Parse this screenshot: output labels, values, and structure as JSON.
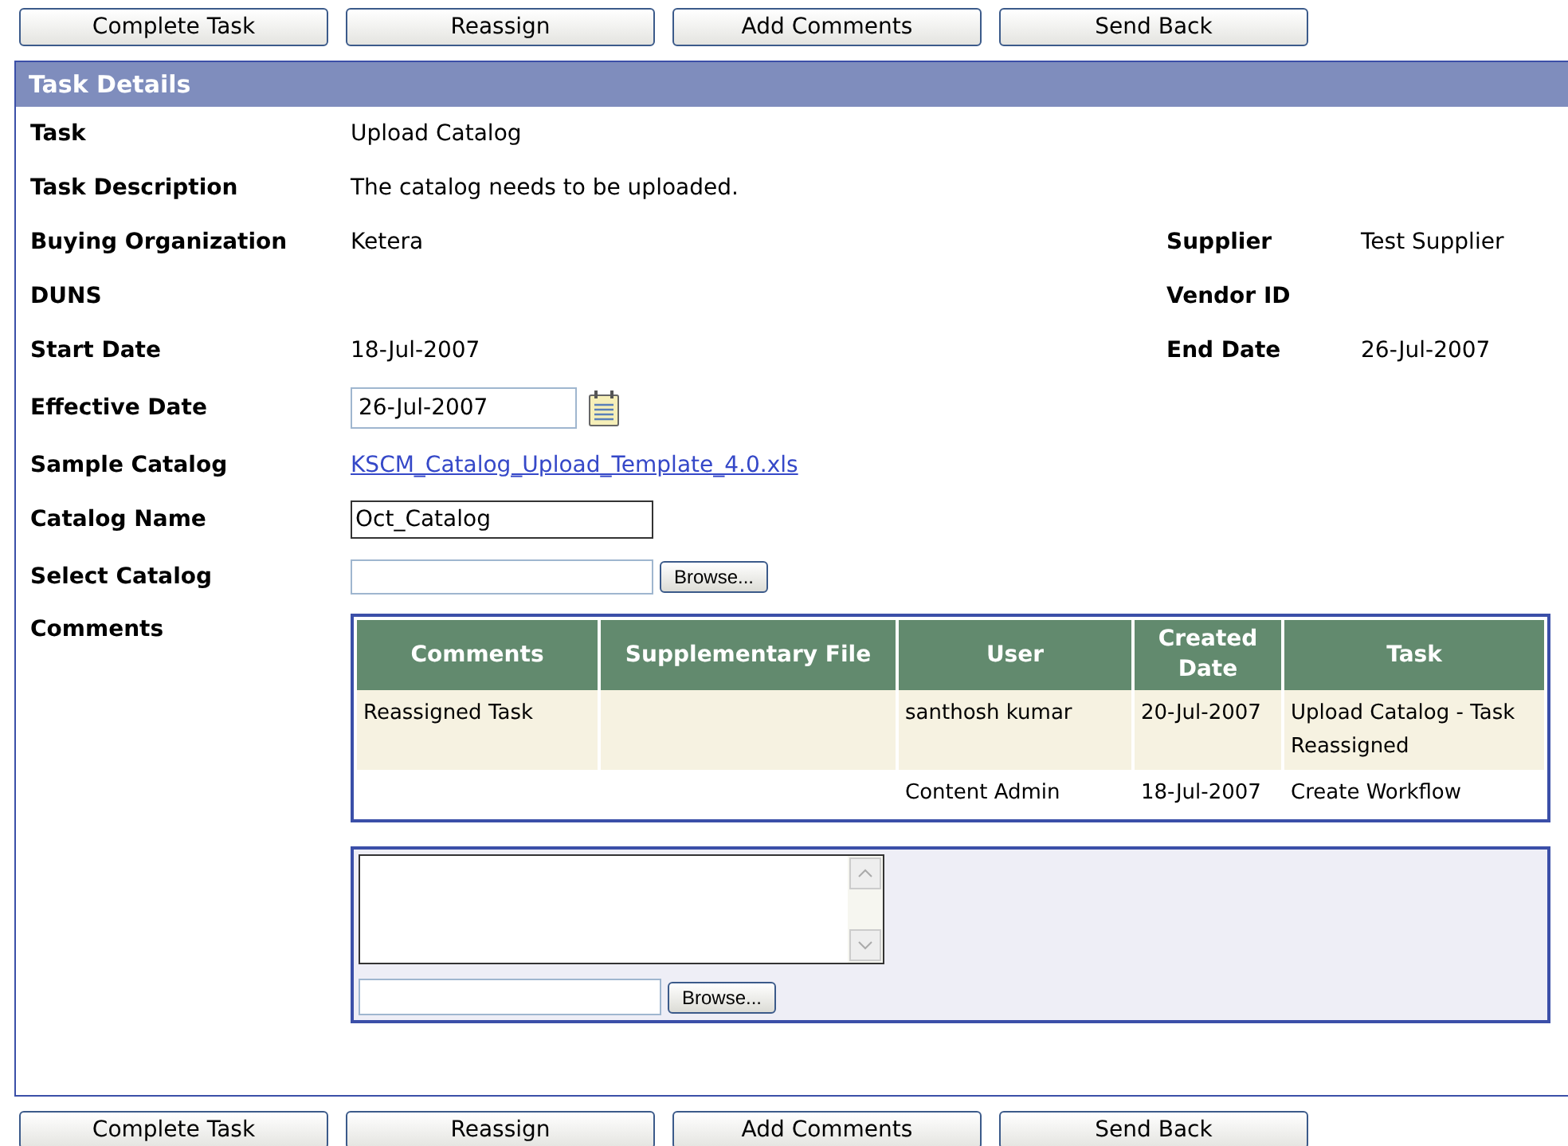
{
  "top_buttons": [
    "Complete Task",
    "Reassign",
    "Add Comments",
    "Send Back"
  ],
  "panel": {
    "title": "Task Details",
    "rows": [
      {
        "kind": "text",
        "label": "Task",
        "value": "Upload Catalog"
      },
      {
        "kind": "text",
        "label": "Task Description",
        "value": "The catalog needs to be uploaded."
      },
      {
        "kind": "text",
        "label": "Buying Organization",
        "value": "Ketera",
        "side_label": "Supplier",
        "side_value": "Test Supplier"
      },
      {
        "kind": "text",
        "label": "DUNS",
        "side_label": "Vendor ID"
      },
      {
        "kind": "text",
        "label": "Start Date",
        "value": "18-Jul-2007",
        "side_label": "End Date",
        "side_value": "26-Jul-2007"
      },
      {
        "kind": "date",
        "label": "Effective Date",
        "value": "26-Jul-2007"
      },
      {
        "kind": "link",
        "label": "Sample Catalog",
        "value": "KSCM_Catalog_Upload_Template_4.0.xls"
      },
      {
        "kind": "input",
        "label": "Catalog Name",
        "value": "Oct_Catalog"
      },
      {
        "kind": "file",
        "label": "Select Catalog",
        "button": "Browse..."
      }
    ],
    "comments": {
      "label": "Comments",
      "columns": [
        "Comments",
        "Supplementary File",
        "User",
        "Created Date",
        "Task"
      ],
      "rows": [
        [
          "Reassigned Task",
          "",
          "santhosh kumar",
          "20-Jul-2007",
          "Upload Catalog - Task Reassigned"
        ],
        [
          "",
          "",
          "Content Admin",
          "18-Jul-2007",
          "Create Workflow"
        ]
      ],
      "new_comment": {
        "button": "Browse..."
      }
    }
  },
  "bottom_buttons": [
    "Complete Task",
    "Reassign",
    "Add Comments",
    "Send Back"
  ]
}
